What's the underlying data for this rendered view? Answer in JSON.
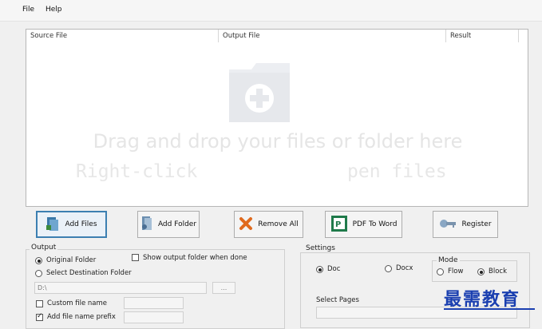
{
  "menu": [
    "File",
    "Help"
  ],
  "columns": {
    "source": "Source File",
    "output": "Output File",
    "result": "Result"
  },
  "dropzone": {
    "line1": "Drag and drop your files or folder here",
    "line2a": "Right-click",
    "line2b": "pen files"
  },
  "buttons": {
    "add_files": "Add Files",
    "add_folder": "Add Folder",
    "remove_all": "Remove All",
    "pdf_to_word": "PDF To Word",
    "register": "Register"
  },
  "output": {
    "title": "Output",
    "original_folder": "Original Folder",
    "select_dest": "Select Destination Folder",
    "show_output": "Show output folder when done",
    "path": "D:\\",
    "browse": "...",
    "custom_name": "Custom file name",
    "prefix": "Add file name prefix"
  },
  "settings": {
    "title": "Settings",
    "doc": "Doc",
    "docx": "Docx",
    "mode_title": "Mode",
    "flow": "Flow",
    "block": "Block",
    "select_pages": "Select Pages"
  },
  "watermark": "最需教育",
  "colors": {
    "accent": "#3c7fb1",
    "watermark": "#1a3fb0"
  }
}
